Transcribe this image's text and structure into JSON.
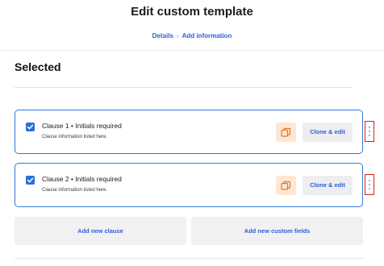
{
  "header": {
    "title": "Edit custom template",
    "breadcrumb": [
      {
        "label": "Details"
      },
      {
        "label": "Add information"
      }
    ],
    "breadcrumb_separator": "›"
  },
  "selected_section": {
    "title": "Selected"
  },
  "clauses": [
    {
      "title": "Clause 1 • Initials required",
      "info": "Clause information listed here.",
      "checked": true,
      "copy_icon": "copy-icon",
      "clone_label": "Clone & edit"
    },
    {
      "title": "Clause 2 • Initials required",
      "info": "Clause information listed here.",
      "checked": true,
      "copy_icon": "copy-icon",
      "clone_label": "Clone & edit"
    }
  ],
  "actions": {
    "add_clause_label": "Add new clause",
    "add_fields_label": "Add new custom fields"
  },
  "colors": {
    "accent": "#2c5fd6",
    "card_border": "#3377dd",
    "copy_bg": "#fde7d4",
    "copy_icon": "#e07a2c",
    "highlight": "#d92020"
  }
}
